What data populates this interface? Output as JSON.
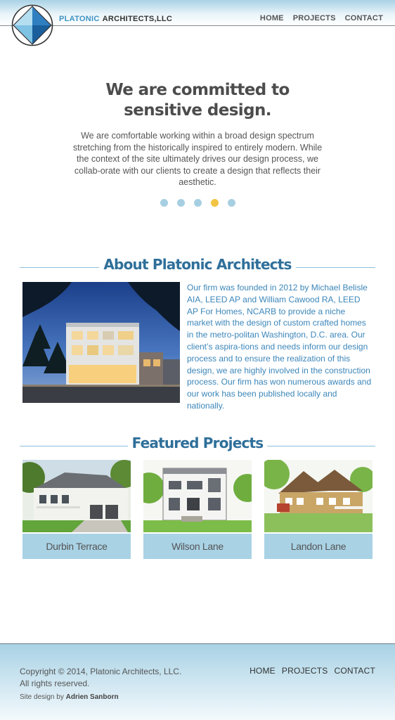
{
  "header": {
    "brand_primary": "PLATONIC",
    "brand_secondary": "ARCHITECTS,LLC",
    "nav": [
      "HOME",
      "PROJECTS",
      "CONTACT"
    ]
  },
  "hero": {
    "title_line1": "We are committed to",
    "title_line2": "sensitive design.",
    "body": "We are comfortable working within a broad design spectrum stretching from the historically inspired to entirely modern. While the context of the site ultimately drives our design process, we collab-orate with our clients to create a design that reflects their aesthetic.",
    "slider_dots": 5,
    "active_dot_index": 3
  },
  "about": {
    "heading": "About Platonic Architects",
    "body": "Our firm was founded in 2012 by Michael Belisle AIA, LEED AP and William Cawood RA, LEED AP For Homes, NCARB to provide a niche market with the design of custom crafted homes in the metro-politan Washington, D.C. area.  Our client’s aspira-tions and needs inform our design process and to ensure the realization of this design, we are highly involved in the construction process. Our firm has won numerous awards and our work has been published locally and nationally."
  },
  "featured": {
    "heading": "Featured Projects",
    "projects": [
      {
        "label": "Durbin Terrace"
      },
      {
        "label": "Wilson Lane"
      },
      {
        "label": "Landon Lane"
      }
    ]
  },
  "footer": {
    "copyright_line1": "Copyright © 2014, Platonic Architects, LLC.",
    "copyright_line2": "All rights reserved.",
    "design_prefix": "Site design by ",
    "design_name": "Adrien Sanborn",
    "nav": [
      "HOME",
      "PROJECTS",
      "CONTACT"
    ]
  },
  "colors": {
    "accent_blue": "#3e93c6",
    "heading_blue": "#2f6f9a",
    "light_blue": "#a9d2e5",
    "active_dot": "#f2c443"
  },
  "icons": [
    "logo-diamond-icon"
  ]
}
